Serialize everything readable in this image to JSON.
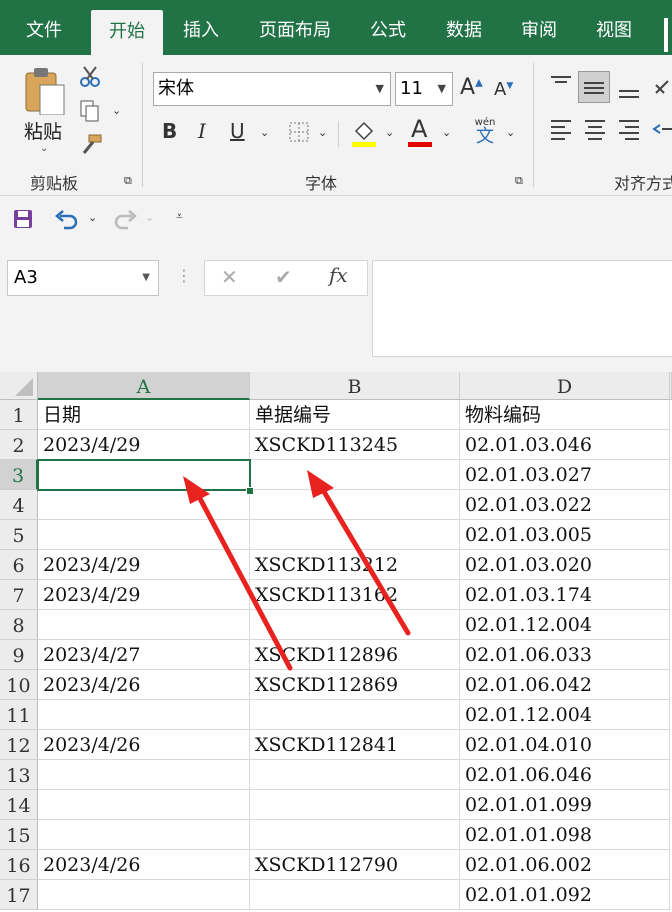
{
  "ribbon_tabs": [
    "文件",
    "开始",
    "插入",
    "页面布局",
    "公式",
    "数据",
    "审阅",
    "视图"
  ],
  "active_tab": "开始",
  "clipboard": {
    "paste_label": "粘贴",
    "group_label": "剪贴板"
  },
  "font": {
    "name": "宋体",
    "size": "11",
    "group_label": "字体",
    "pinyin": "wén",
    "wen_char": "文",
    "bold": "B",
    "italic": "I",
    "underline": "U",
    "font_color_letter": "A",
    "increase": "A",
    "decrease": "A"
  },
  "alignment": {
    "group_label": "对齐方式"
  },
  "colors": {
    "accent": "#217346",
    "highlight": "#ffff00",
    "font_color": "#e00000",
    "arrow": "#e8231f"
  },
  "name_box": "A3",
  "formula_icons": {
    "cancel": "✕",
    "enter": "✔",
    "fx": "fx"
  },
  "formula_value": "",
  "columns": [
    "A",
    "B",
    "D"
  ],
  "selected_column": "A",
  "selected_row": "3",
  "rows": [
    {
      "num": "1",
      "a": "日期",
      "b": "单据编号",
      "d": "物料编码"
    },
    {
      "num": "2",
      "a": "2023/4/29",
      "b": "XSCKD113245",
      "d": "02.01.03.046"
    },
    {
      "num": "3",
      "a": "",
      "b": "",
      "d": "02.01.03.027"
    },
    {
      "num": "4",
      "a": "",
      "b": "",
      "d": "02.01.03.022"
    },
    {
      "num": "5",
      "a": "",
      "b": "",
      "d": "02.01.03.005"
    },
    {
      "num": "6",
      "a": "2023/4/29",
      "b": "XSCKD113212",
      "d": "02.01.03.020"
    },
    {
      "num": "7",
      "a": "2023/4/29",
      "b": "XSCKD113162",
      "d": "02.01.03.174"
    },
    {
      "num": "8",
      "a": "",
      "b": "",
      "d": "02.01.12.004"
    },
    {
      "num": "9",
      "a": "2023/4/27",
      "b": "XSCKD112896",
      "d": "02.01.06.033"
    },
    {
      "num": "10",
      "a": "2023/4/26",
      "b": "XSCKD112869",
      "d": "02.01.06.042"
    },
    {
      "num": "11",
      "a": "",
      "b": "",
      "d": "02.01.12.004"
    },
    {
      "num": "12",
      "a": "2023/4/26",
      "b": "XSCKD112841",
      "d": "02.01.04.010"
    },
    {
      "num": "13",
      "a": "",
      "b": "",
      "d": "02.01.06.046"
    },
    {
      "num": "14",
      "a": "",
      "b": "",
      "d": "02.01.01.099"
    },
    {
      "num": "15",
      "a": "",
      "b": "",
      "d": "02.01.01.098"
    },
    {
      "num": "16",
      "a": "2023/4/26",
      "b": "XSCKD112790",
      "d": "02.01.06.002"
    },
    {
      "num": "17",
      "a": "",
      "b": "",
      "d": "02.01.01.092"
    }
  ]
}
